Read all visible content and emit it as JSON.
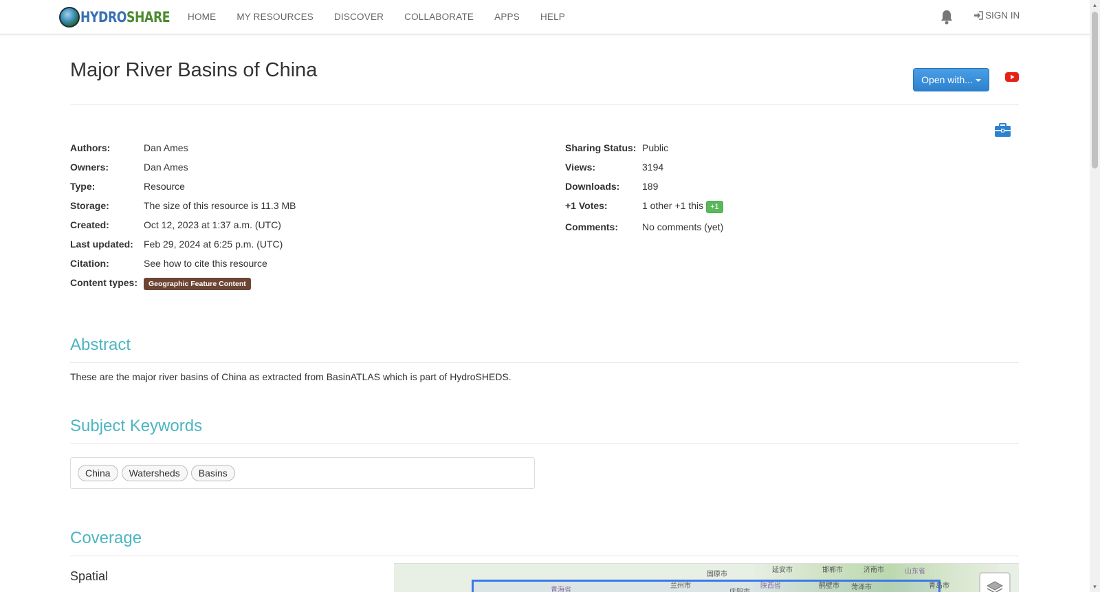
{
  "nav": {
    "logo": {
      "part1": "HYDRO",
      "part2": "SHARE"
    },
    "links": [
      "HOME",
      "MY RESOURCES",
      "DISCOVER",
      "COLLABORATE",
      "APPS",
      "HELP"
    ],
    "sign_in": "SIGN IN"
  },
  "resource": {
    "title": "Major River Basins of China",
    "open_with": "Open with..."
  },
  "meta_left": [
    {
      "label": "Authors:",
      "value": "Dan Ames",
      "link": true
    },
    {
      "label": "Owners:",
      "value": "Dan Ames",
      "link": true
    },
    {
      "label": "Type:",
      "value": "Resource",
      "link": false
    },
    {
      "label": "Storage:",
      "value": "The size of this resource is 11.3 MB",
      "link": false
    },
    {
      "label": "Created:",
      "value": "Oct 12, 2023 at 1:37 a.m. (UTC)",
      "link": false
    },
    {
      "label": "Last updated:",
      "value": "Feb 29, 2024 at 6:25 p.m. (UTC)",
      "link": false
    },
    {
      "label": "Citation:",
      "value": "See how to cite this resource",
      "link": true
    }
  ],
  "content_types": {
    "label": "Content types:",
    "badge": "Geographic Feature Content"
  },
  "meta_right": {
    "sharing": {
      "label": "Sharing Status:",
      "value": "Public"
    },
    "views": {
      "label": "Views:",
      "value": "3194"
    },
    "downloads": {
      "label": "Downloads:",
      "value": "189"
    },
    "votes": {
      "label": "+1 Votes:",
      "value": "1 other +1 this",
      "button": "+1"
    },
    "comments": {
      "label": "Comments:",
      "value": "No comments (yet)"
    }
  },
  "abstract": {
    "heading": "Abstract",
    "text": "These are the major river basins of China as extracted from BasinATLAS which is part of HydroSHEDS."
  },
  "keywords": {
    "heading": "Subject Keywords",
    "items": [
      "China",
      "Watersheds",
      "Basins"
    ]
  },
  "coverage": {
    "heading": "Coverage",
    "spatial": "Spatial",
    "map_labels": [
      "固原市",
      "延安市",
      "邯郸市",
      "济南市",
      "山东省",
      "青海省",
      "兰州市",
      "陕西省",
      "鹤壁市",
      "菏泽市",
      "青岛市",
      "庆阳市"
    ]
  },
  "colors": {
    "accent": "#4bb5c1",
    "link": "#3479c0",
    "primary_button": "#2d82cf",
    "badge_brown": "#6d4535",
    "plus_green": "#5cb85c"
  }
}
